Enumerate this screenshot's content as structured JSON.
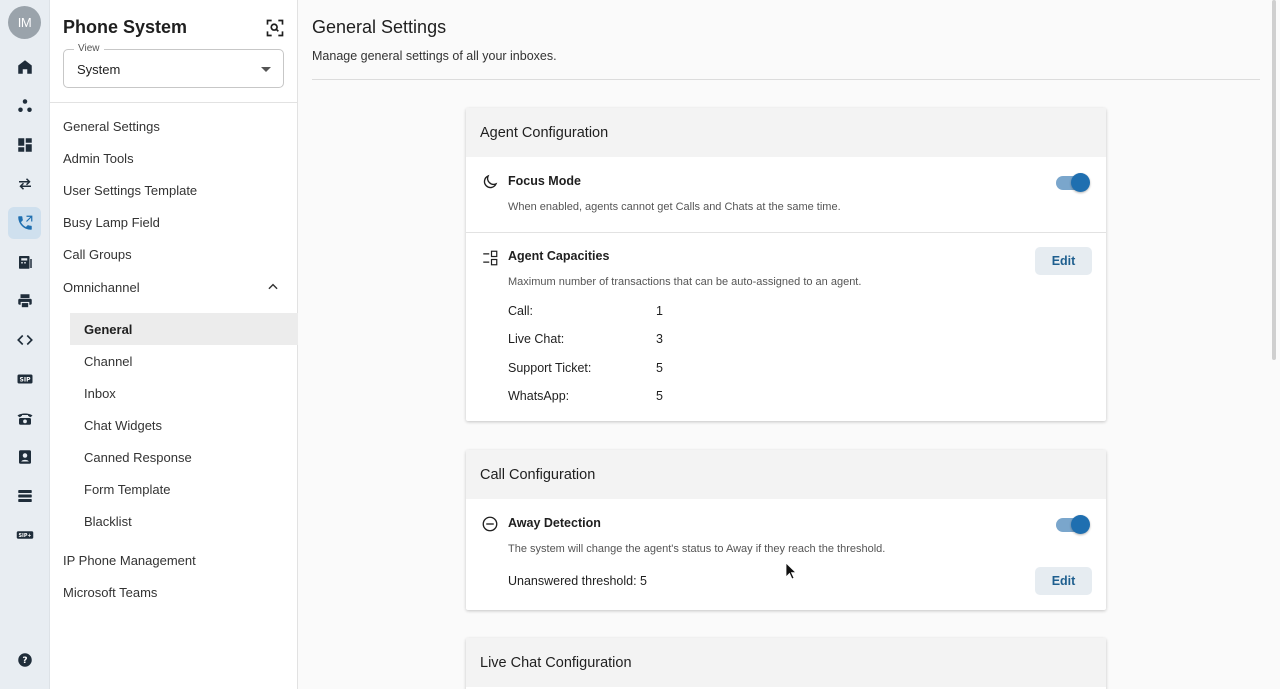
{
  "rail": {
    "avatar_initials": "IM",
    "items": [
      {
        "icon": "home-icon"
      },
      {
        "icon": "network-icon"
      },
      {
        "icon": "dashboard-icon"
      },
      {
        "icon": "transfer-icon"
      },
      {
        "icon": "phone-system-icon",
        "active": true
      },
      {
        "icon": "fax-icon"
      },
      {
        "icon": "printer-icon"
      },
      {
        "icon": "code-icon"
      },
      {
        "icon": "sip-icon",
        "label": "SIP"
      },
      {
        "icon": "desk-phone-icon"
      },
      {
        "icon": "contact-book-icon"
      },
      {
        "icon": "list-icon"
      },
      {
        "icon": "sip-plus-icon",
        "label": "SIP+"
      }
    ],
    "help_icon": "help-icon"
  },
  "sidebar": {
    "title": "Phone System",
    "view": {
      "legend": "View",
      "value": "System"
    },
    "items": [
      {
        "label": "General Settings"
      },
      {
        "label": "Admin Tools"
      },
      {
        "label": "User Settings Template"
      },
      {
        "label": "Busy Lamp Field"
      },
      {
        "label": "Call Groups"
      },
      {
        "label": "Omnichannel",
        "expanded": true
      }
    ],
    "sub_items": [
      {
        "label": "General",
        "active": true
      },
      {
        "label": "Channel"
      },
      {
        "label": "Inbox"
      },
      {
        "label": "Chat Widgets"
      },
      {
        "label": "Canned Response"
      },
      {
        "label": "Form Template"
      },
      {
        "label": "Blacklist"
      }
    ],
    "bottom_items": [
      {
        "label": "IP Phone Management"
      },
      {
        "label": "Microsoft Teams"
      }
    ]
  },
  "main": {
    "title": "General Settings",
    "subtitle": "Manage general settings of all your inboxes.",
    "agent_config": {
      "heading": "Agent Configuration",
      "focus_mode": {
        "title": "Focus Mode",
        "description": "When enabled, agents cannot get Calls and Chats at the same time.",
        "enabled": true
      },
      "capacities": {
        "title": "Agent Capacities",
        "description": "Maximum number of transactions that can be auto-assigned to an agent.",
        "edit_label": "Edit",
        "rows": [
          {
            "label": "Call:",
            "value": "1"
          },
          {
            "label": "Live Chat:",
            "value": "3"
          },
          {
            "label": "Support Ticket:",
            "value": "5"
          },
          {
            "label": "WhatsApp:",
            "value": "5"
          }
        ]
      }
    },
    "call_config": {
      "heading": "Call Configuration",
      "away_detection": {
        "title": "Away Detection",
        "description": "The system will change the agent's status to Away if they reach the threshold.",
        "enabled": true,
        "threshold_text": "Unanswered threshold: 5",
        "edit_label": "Edit"
      }
    },
    "live_chat_config": {
      "heading": "Live Chat Configuration"
    }
  },
  "colors": {
    "accent": "#1f6fb0",
    "rail_bg": "#e8edf2",
    "active_rail": "#cfe0ee"
  }
}
